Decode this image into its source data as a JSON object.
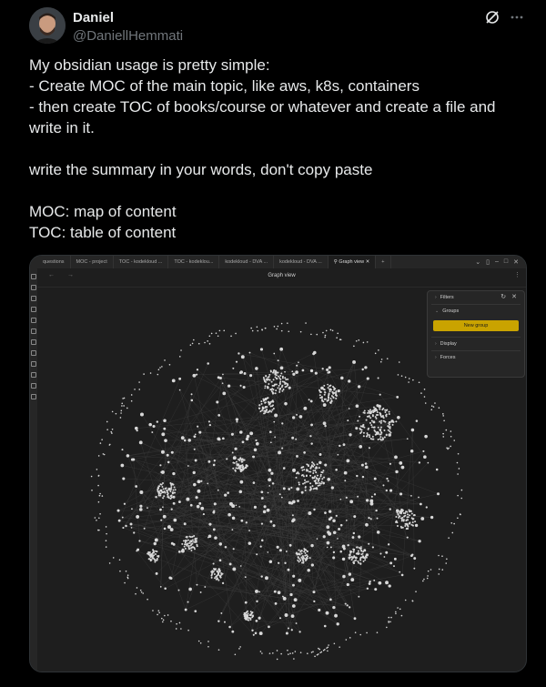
{
  "author": {
    "name": "Daniel",
    "handle": "@DaniellHemmati"
  },
  "tweet": {
    "text": "My obsidian usage is pretty simple:\n- Create MOC of the main topic, like aws, k8s, containers\n- then create TOC of books/course or whatever and create a file and write in it.\n\nwrite the summary in your words, don't copy paste\n\nMOC: map of content\nTOC: table of content"
  },
  "header_icons": [
    "grok-icon",
    "more-icon"
  ],
  "screenshot": {
    "tabs": [
      {
        "label": "questions",
        "active": false
      },
      {
        "label": "MOC - project",
        "active": false
      },
      {
        "label": "TOC - kodekloud ...",
        "active": false
      },
      {
        "label": "TOC - kodeklou...",
        "active": false
      },
      {
        "label": "kodekloud - DVA ...",
        "active": false
      },
      {
        "label": "kodekloud - DVA ...",
        "active": false
      },
      {
        "label": "Graph view",
        "active": true
      }
    ],
    "view_title": "Graph view",
    "panel": {
      "filters_label": "Filters",
      "groups_label": "Groups",
      "new_group_button": "New group",
      "display_label": "Display",
      "forces_label": "Forces"
    }
  }
}
